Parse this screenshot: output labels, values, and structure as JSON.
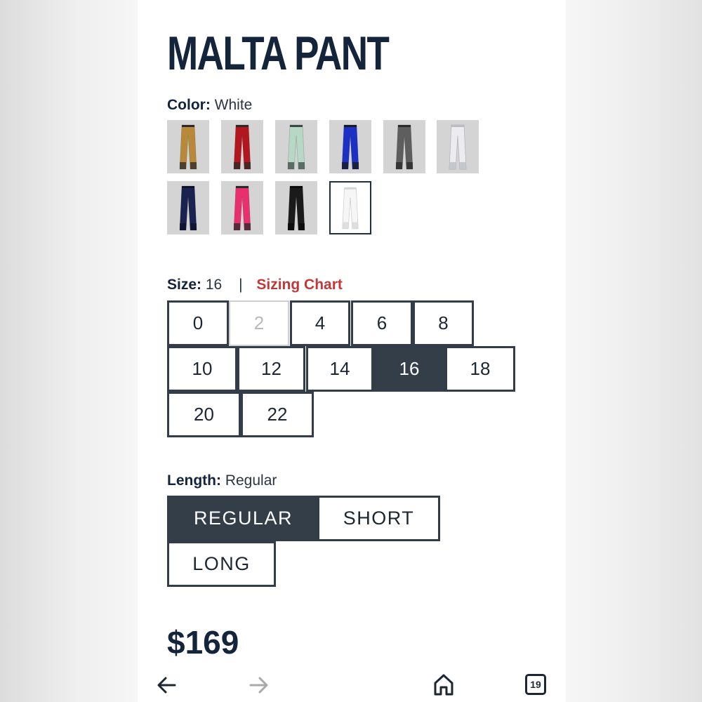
{
  "product": {
    "title": "MALTA PANT",
    "price": "$169"
  },
  "color": {
    "label": "Color:",
    "selected": "White",
    "swatches": [
      {
        "name": "Tan",
        "pant": "#b8893a",
        "accent": "#2a2a2a",
        "selected": false
      },
      {
        "name": "Red",
        "pant": "#b3161f",
        "accent": "#2a2a2a",
        "selected": false
      },
      {
        "name": "Mint",
        "pant": "#b7d8c4",
        "accent": "#3a4a44",
        "selected": false
      },
      {
        "name": "Royal Blue",
        "pant": "#1c31c4",
        "accent": "#1a1a1a",
        "selected": false
      },
      {
        "name": "Grey",
        "pant": "#5e5e5e",
        "accent": "#2a2a2a",
        "selected": false
      },
      {
        "name": "Light Grey",
        "pant": "#ececf0",
        "accent": "#b9bcc4",
        "selected": false
      },
      {
        "name": "Navy",
        "pant": "#1a2350",
        "accent": "#0d1128",
        "selected": false
      },
      {
        "name": "Pink",
        "pant": "#e8306e",
        "accent": "#2a2a2a",
        "selected": false
      },
      {
        "name": "Black",
        "pant": "#1a1a1a",
        "accent": "#0a0a0a",
        "selected": false
      },
      {
        "name": "White",
        "pant": "#f6f6f6",
        "accent": "#d6d6d6",
        "selected": true
      }
    ]
  },
  "size": {
    "label": "Size:",
    "selected": "16",
    "separator": "|",
    "chart_link": "Sizing Chart",
    "options": [
      {
        "value": "0",
        "state": "normal"
      },
      {
        "value": "2",
        "state": "disabled"
      },
      {
        "value": "4",
        "state": "normal"
      },
      {
        "value": "6",
        "state": "normal"
      },
      {
        "value": "8",
        "state": "normal"
      },
      {
        "value": "10",
        "state": "normal"
      },
      {
        "value": "12",
        "state": "normal"
      },
      {
        "value": "14",
        "state": "normal"
      },
      {
        "value": "16",
        "state": "selected"
      },
      {
        "value": "18",
        "state": "normal"
      },
      {
        "value": "20",
        "state": "normal"
      },
      {
        "value": "22",
        "state": "normal"
      }
    ]
  },
  "length": {
    "label": "Length:",
    "selected": "Regular",
    "options": [
      {
        "value": "REGULAR",
        "state": "selected"
      },
      {
        "value": "SHORT",
        "state": "normal"
      },
      {
        "value": "LONG",
        "state": "normal"
      }
    ]
  },
  "nav": {
    "back_icon": "arrow-left-icon",
    "forward_icon": "arrow-right-icon",
    "home_icon": "home-icon",
    "tabs_icon": "tabs-icon",
    "tabs_count": "19"
  }
}
